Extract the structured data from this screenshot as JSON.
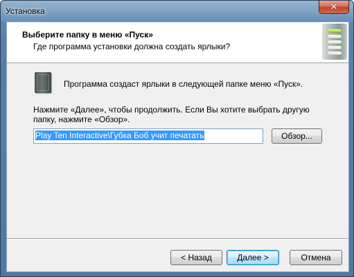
{
  "window": {
    "title": "Установка",
    "close_icon": "close-icon"
  },
  "header": {
    "title": "Выберите папку в меню «Пуск»",
    "subtitle": "Где программа установки должна создать ярлыки?",
    "graphic_icon": "setup-progress-icon"
  },
  "main": {
    "folder_icon": "start-menu-folder-icon",
    "info_text": "Программа создаст ярлыки в следующей папке меню «Пуск».",
    "instruction_text": "Нажмите «Далее», чтобы продолжить. Если Вы хотите выбрать другую папку, нажмите «Обзор».",
    "folder_value": "Play Ten Interactive\\Губка Боб учит печатать",
    "browse_label": "Обзор..."
  },
  "footer": {
    "back_label": "< Назад",
    "next_label": "Далее >",
    "cancel_label": "Отмена"
  },
  "colors": {
    "selection": "#3399ff",
    "accent_green": "#8ed21c",
    "close_red": "#c0422a"
  }
}
